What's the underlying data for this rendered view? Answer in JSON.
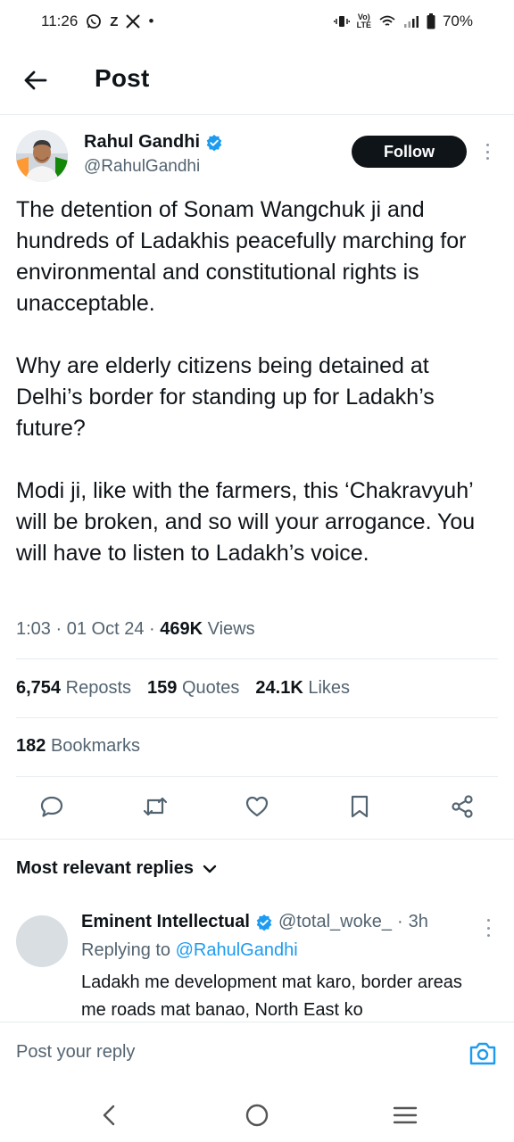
{
  "status_bar": {
    "time": "11:26",
    "notif_z": "Z",
    "notif_dot": "•",
    "volte": "Vo)",
    "lte": "LTE",
    "battery": "70%"
  },
  "header": {
    "title": "Post"
  },
  "post": {
    "author_name": "Rahul Gandhi",
    "author_handle": "@RahulGandhi",
    "follow_label": "Follow",
    "paragraphs": [
      "The detention of Sonam Wangchuk ji and hundreds of Ladakhis peacefully marching for environmental and constitutional rights is unacceptable.",
      "Why are elderly citizens being detained at Delhi’s border for standing up for Ladakh’s future?",
      "Modi ji, like with the farmers, this ‘Chakravyuh’ will be broken, and so will your arrogance. You will have to listen to Ladakh’s voice."
    ],
    "time": "1:03",
    "sep": "·",
    "date": "01 Oct 24",
    "views_count": "469K",
    "views_label": "Views",
    "reposts_count": "6,754",
    "reposts_label": "Reposts",
    "quotes_count": "159",
    "quotes_label": "Quotes",
    "likes_count": "24.1K",
    "likes_label": "Likes",
    "bookmarks_count": "182",
    "bookmarks_label": "Bookmarks"
  },
  "replies": {
    "filter_label": "Most relevant replies",
    "items": [
      {
        "name": "Eminent Intellectual",
        "handle": "@total_woke_",
        "sep": "·",
        "time": "3h",
        "replying_prefix": "Replying to",
        "replying_to": "@RahulGandhi",
        "text": "Ladakh me development mat karo, border areas me roads mat banao, North East ko"
      }
    ]
  },
  "composer": {
    "placeholder": "Post your reply"
  },
  "colors": {
    "text": "#0f1419",
    "secondary": "#536471",
    "link": "#1d9bf0",
    "verified": "#1d9bf0",
    "divider": "#e6ecf0"
  },
  "icons": [
    "whatsapp-icon",
    "x-logo-icon",
    "vibrate-icon",
    "wifi-icon",
    "signal-icon",
    "battery-icon",
    "back-arrow-icon",
    "verified-badge-icon",
    "more-vertical-icon",
    "reply-icon",
    "repost-icon",
    "like-icon",
    "bookmark-icon",
    "share-icon",
    "chevron-down-icon",
    "camera-icon",
    "nav-back-icon",
    "nav-home-icon",
    "nav-recents-icon"
  ]
}
